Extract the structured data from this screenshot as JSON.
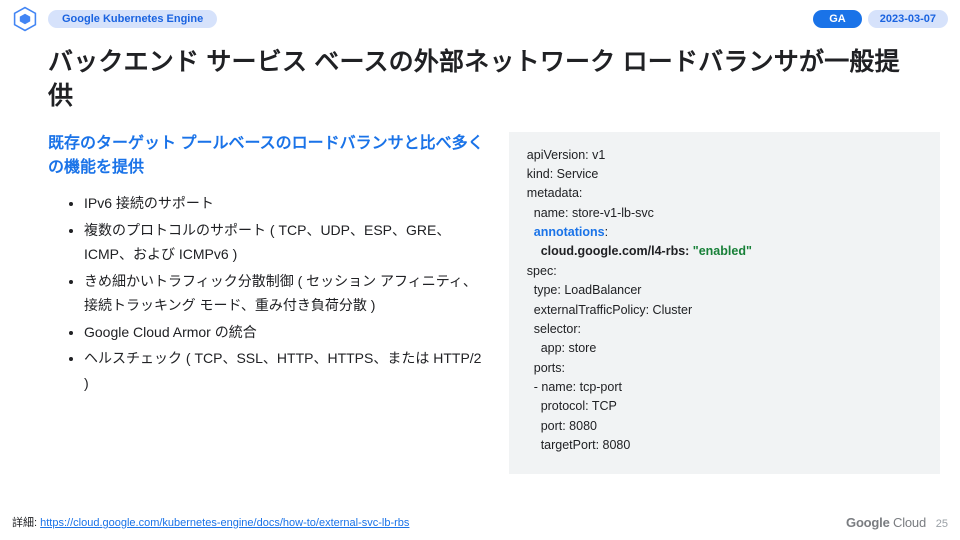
{
  "header": {
    "product": "Google Kubernetes Engine",
    "ga": "GA",
    "date": "2023-03-07"
  },
  "title": "バックエンド サービス ベースの外部ネットワーク ロードバランサが一般提供",
  "subhead": "既存のターゲット プールベースのロードバランサと比べ多くの機能を提供",
  "bullets": [
    "IPv6 接続のサポート",
    "複数のプロトコルのサポート ( TCP、UDP、ESP、GRE、ICMP、および ICMPv6 )",
    "きめ細かいトラフィック分散制御 ( セッション アフィニティ、接続トラッキング モード、重み付き負荷分散 )",
    "Google Cloud Armor の統合",
    "ヘルスチェック ( TCP、SSL、HTTP、HTTPS、または HTTP/2 )"
  ],
  "code": {
    "l1": "apiVersion: v1",
    "l2": "kind: Service",
    "l3": "metadata:",
    "l4": "  name: store-v1-lb-svc",
    "l5a": "  ",
    "l5b": "annotations",
    "l5c": ":",
    "l6a": "    ",
    "l6b": "cloud.google.com/l4-rbs: ",
    "l6c": "\"enabled\"",
    "l7": "spec:",
    "l8": "  type: LoadBalancer",
    "l9": "  externalTrafficPolicy: Cluster",
    "l10": "  selector:",
    "l11": "    app: store",
    "l12": "  ports:",
    "l13": "  - name: tcp-port",
    "l14": "    protocol: TCP",
    "l15": "    port: 8080",
    "l16": "    targetPort: 8080"
  },
  "footer": {
    "label": "詳細: ",
    "link_text": "https://cloud.google.com/kubernetes-engine/docs/how-to/external-svc-lb-rbs",
    "link_href": "https://cloud.google.com/kubernetes-engine/docs/how-to/external-svc-lb-rbs"
  },
  "logo": {
    "g": "Google",
    "c": " Cloud"
  },
  "page": "25"
}
